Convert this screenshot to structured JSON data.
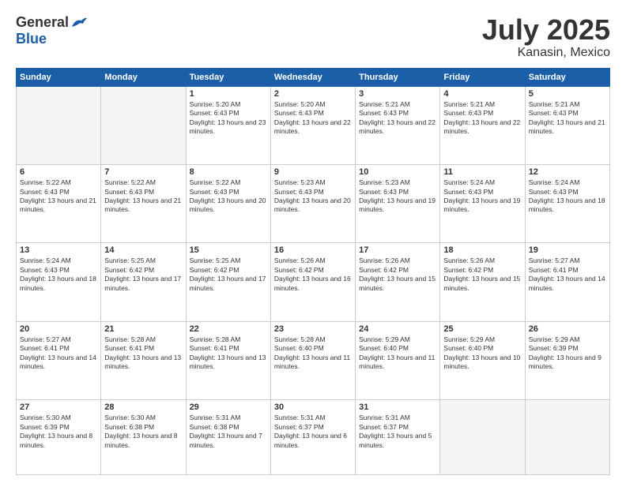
{
  "header": {
    "logo": {
      "general": "General",
      "blue": "Blue"
    },
    "title": "July 2025",
    "location": "Kanasin, Mexico"
  },
  "calendar": {
    "days_of_week": [
      "Sunday",
      "Monday",
      "Tuesday",
      "Wednesday",
      "Thursday",
      "Friday",
      "Saturday"
    ],
    "weeks": [
      [
        {
          "day": "",
          "info": ""
        },
        {
          "day": "",
          "info": ""
        },
        {
          "day": "1",
          "info": "Sunrise: 5:20 AM\nSunset: 6:43 PM\nDaylight: 13 hours and 23 minutes."
        },
        {
          "day": "2",
          "info": "Sunrise: 5:20 AM\nSunset: 6:43 PM\nDaylight: 13 hours and 22 minutes."
        },
        {
          "day": "3",
          "info": "Sunrise: 5:21 AM\nSunset: 6:43 PM\nDaylight: 13 hours and 22 minutes."
        },
        {
          "day": "4",
          "info": "Sunrise: 5:21 AM\nSunset: 6:43 PM\nDaylight: 13 hours and 22 minutes."
        },
        {
          "day": "5",
          "info": "Sunrise: 5:21 AM\nSunset: 6:43 PM\nDaylight: 13 hours and 21 minutes."
        }
      ],
      [
        {
          "day": "6",
          "info": "Sunrise: 5:22 AM\nSunset: 6:43 PM\nDaylight: 13 hours and 21 minutes."
        },
        {
          "day": "7",
          "info": "Sunrise: 5:22 AM\nSunset: 6:43 PM\nDaylight: 13 hours and 21 minutes."
        },
        {
          "day": "8",
          "info": "Sunrise: 5:22 AM\nSunset: 6:43 PM\nDaylight: 13 hours and 20 minutes."
        },
        {
          "day": "9",
          "info": "Sunrise: 5:23 AM\nSunset: 6:43 PM\nDaylight: 13 hours and 20 minutes."
        },
        {
          "day": "10",
          "info": "Sunrise: 5:23 AM\nSunset: 6:43 PM\nDaylight: 13 hours and 19 minutes."
        },
        {
          "day": "11",
          "info": "Sunrise: 5:24 AM\nSunset: 6:43 PM\nDaylight: 13 hours and 19 minutes."
        },
        {
          "day": "12",
          "info": "Sunrise: 5:24 AM\nSunset: 6:43 PM\nDaylight: 13 hours and 18 minutes."
        }
      ],
      [
        {
          "day": "13",
          "info": "Sunrise: 5:24 AM\nSunset: 6:43 PM\nDaylight: 13 hours and 18 minutes."
        },
        {
          "day": "14",
          "info": "Sunrise: 5:25 AM\nSunset: 6:42 PM\nDaylight: 13 hours and 17 minutes."
        },
        {
          "day": "15",
          "info": "Sunrise: 5:25 AM\nSunset: 6:42 PM\nDaylight: 13 hours and 17 minutes."
        },
        {
          "day": "16",
          "info": "Sunrise: 5:26 AM\nSunset: 6:42 PM\nDaylight: 13 hours and 16 minutes."
        },
        {
          "day": "17",
          "info": "Sunrise: 5:26 AM\nSunset: 6:42 PM\nDaylight: 13 hours and 15 minutes."
        },
        {
          "day": "18",
          "info": "Sunrise: 5:26 AM\nSunset: 6:42 PM\nDaylight: 13 hours and 15 minutes."
        },
        {
          "day": "19",
          "info": "Sunrise: 5:27 AM\nSunset: 6:41 PM\nDaylight: 13 hours and 14 minutes."
        }
      ],
      [
        {
          "day": "20",
          "info": "Sunrise: 5:27 AM\nSunset: 6:41 PM\nDaylight: 13 hours and 14 minutes."
        },
        {
          "day": "21",
          "info": "Sunrise: 5:28 AM\nSunset: 6:41 PM\nDaylight: 13 hours and 13 minutes."
        },
        {
          "day": "22",
          "info": "Sunrise: 5:28 AM\nSunset: 6:41 PM\nDaylight: 13 hours and 13 minutes."
        },
        {
          "day": "23",
          "info": "Sunrise: 5:28 AM\nSunset: 6:40 PM\nDaylight: 13 hours and 11 minutes."
        },
        {
          "day": "24",
          "info": "Sunrise: 5:29 AM\nSunset: 6:40 PM\nDaylight: 13 hours and 11 minutes."
        },
        {
          "day": "25",
          "info": "Sunrise: 5:29 AM\nSunset: 6:40 PM\nDaylight: 13 hours and 10 minutes."
        },
        {
          "day": "26",
          "info": "Sunrise: 5:29 AM\nSunset: 6:39 PM\nDaylight: 13 hours and 9 minutes."
        }
      ],
      [
        {
          "day": "27",
          "info": "Sunrise: 5:30 AM\nSunset: 6:39 PM\nDaylight: 13 hours and 8 minutes."
        },
        {
          "day": "28",
          "info": "Sunrise: 5:30 AM\nSunset: 6:38 PM\nDaylight: 13 hours and 8 minutes."
        },
        {
          "day": "29",
          "info": "Sunrise: 5:31 AM\nSunset: 6:38 PM\nDaylight: 13 hours and 7 minutes."
        },
        {
          "day": "30",
          "info": "Sunrise: 5:31 AM\nSunset: 6:37 PM\nDaylight: 13 hours and 6 minutes."
        },
        {
          "day": "31",
          "info": "Sunrise: 5:31 AM\nSunset: 6:37 PM\nDaylight: 13 hours and 5 minutes."
        },
        {
          "day": "",
          "info": ""
        },
        {
          "day": "",
          "info": ""
        }
      ]
    ]
  }
}
